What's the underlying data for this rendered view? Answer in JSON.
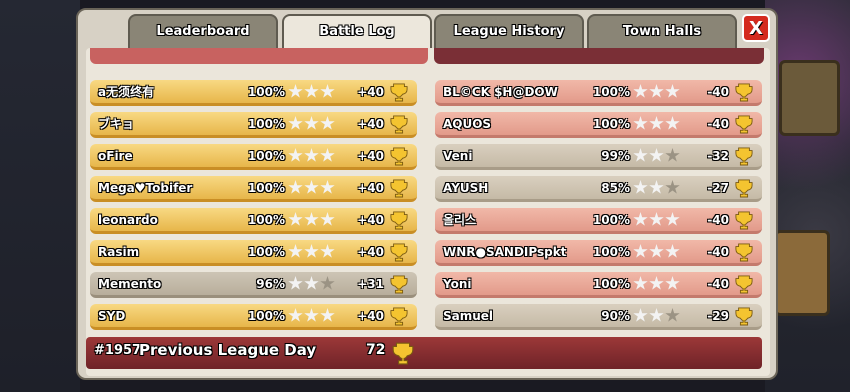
{
  "tabs": [
    {
      "label": "Leaderboard"
    },
    {
      "label": "Battle Log"
    },
    {
      "label": "League History"
    },
    {
      "label": "Town Halls"
    }
  ],
  "close_label": "X",
  "attacks": [
    {
      "name": "a无须终有",
      "percent": "100%",
      "stars": 3,
      "score": "+40"
    },
    {
      "name": "ブキョ",
      "percent": "100%",
      "stars": 3,
      "score": "+40"
    },
    {
      "name": "oFire",
      "percent": "100%",
      "stars": 3,
      "score": "+40"
    },
    {
      "name": "Mega♥Tobifer",
      "percent": "100%",
      "stars": 3,
      "score": "+40"
    },
    {
      "name": "leonardo",
      "percent": "100%",
      "stars": 3,
      "score": "+40"
    },
    {
      "name": "Rasim",
      "percent": "100%",
      "stars": 3,
      "score": "+40"
    },
    {
      "name": "Memento",
      "percent": "96%",
      "stars": 2,
      "score": "+31"
    },
    {
      "name": "SYD",
      "percent": "100%",
      "stars": 3,
      "score": "+40"
    }
  ],
  "defenses": [
    {
      "name": "BL©CK $H@DOW",
      "percent": "100%",
      "stars": 3,
      "score": "-40"
    },
    {
      "name": "AQUOS",
      "percent": "100%",
      "stars": 3,
      "score": "-40"
    },
    {
      "name": "Veni",
      "percent": "99%",
      "stars": 2,
      "score": "-32"
    },
    {
      "name": "AYUSH",
      "percent": "85%",
      "stars": 2,
      "score": "-27"
    },
    {
      "name": "올리스",
      "percent": "100%",
      "stars": 3,
      "score": "-40"
    },
    {
      "name": "WNR●SANDIPspkt",
      "percent": "100%",
      "stars": 3,
      "score": "-40"
    },
    {
      "name": "Yoni",
      "percent": "100%",
      "stars": 3,
      "score": "-40"
    },
    {
      "name": "Samuel",
      "percent": "90%",
      "stars": 2,
      "score": "-29"
    }
  ],
  "footer": {
    "day_number": "#1957",
    "title": "Previous League Day",
    "total": "72"
  },
  "colors": {
    "win": "#e7b64a",
    "loss": "#e29a8a",
    "tab_active": "#ece7dc",
    "close": "#d42a1e"
  },
  "icons": {
    "trophy": "trophy-icon",
    "star": "star-icon"
  }
}
